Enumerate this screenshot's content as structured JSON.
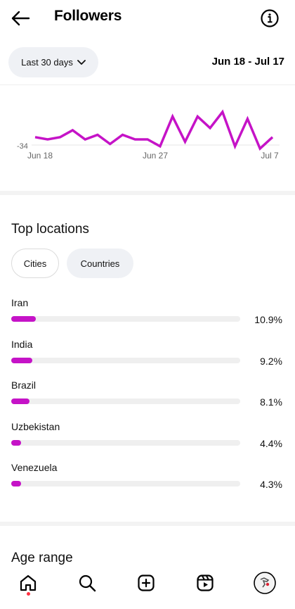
{
  "header": {
    "title": "Followers",
    "back_icon": "arrow-left-icon",
    "info_icon": "info-circle-icon"
  },
  "period": {
    "selected": "Last 30 days",
    "date_range": "Jun 18 - Jul 17"
  },
  "chart_data": {
    "type": "line",
    "x_ticks": [
      "Jun 18",
      "Jun 27",
      "Jul 7"
    ],
    "y_tick": "-34",
    "series": [
      {
        "color": "#c513c7",
        "values": [
          -31,
          -32,
          -31,
          -28,
          -32,
          -30,
          -34,
          -30,
          -32,
          -32,
          -35,
          -22,
          -33,
          -22,
          -27,
          -20,
          -35,
          -23,
          -36,
          -31
        ]
      }
    ],
    "ylim": [
      -36,
      -16
    ]
  },
  "locations": {
    "title": "Top locations",
    "tabs": [
      {
        "label": "Cities",
        "selected": true
      },
      {
        "label": "Countries",
        "selected": false
      }
    ],
    "items": [
      {
        "name": "Iran",
        "percent": "10.9%",
        "value": 10.9
      },
      {
        "name": "India",
        "percent": "9.2%",
        "value": 9.2
      },
      {
        "name": "Brazil",
        "percent": "8.1%",
        "value": 8.1
      },
      {
        "name": "Uzbekistan",
        "percent": "4.4%",
        "value": 4.4
      },
      {
        "name": "Venezuela",
        "percent": "4.3%",
        "value": 4.3
      }
    ],
    "bar_color": "#c513c7"
  },
  "age": {
    "title": "Age range"
  },
  "nav": {
    "items": [
      "home-icon",
      "search-icon",
      "create-icon",
      "reels-icon",
      "profile-avatar"
    ],
    "active": "home-icon"
  }
}
